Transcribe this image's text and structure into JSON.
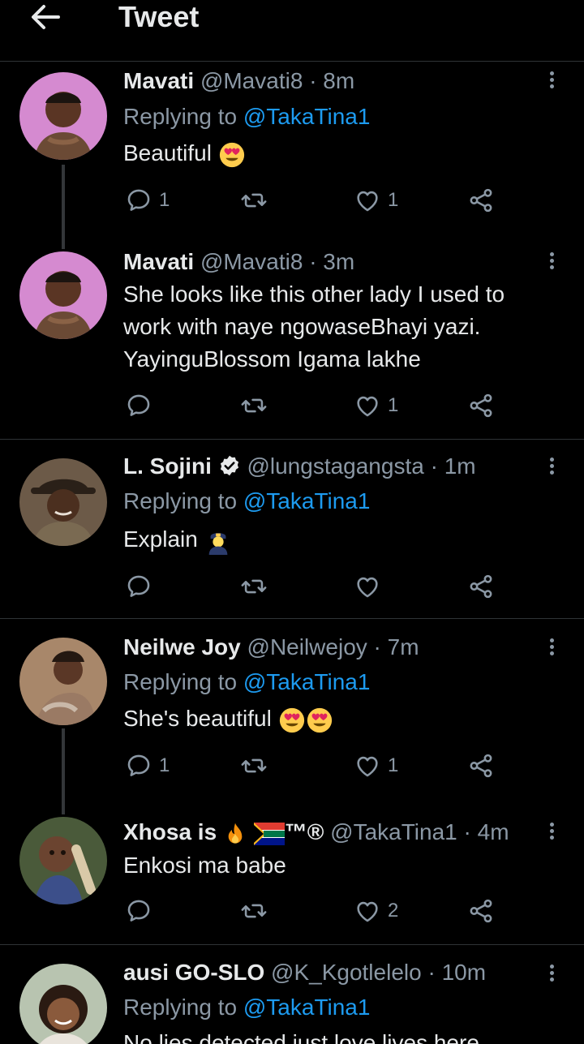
{
  "header": {
    "title": "Tweet"
  },
  "tweets": [
    {
      "name": "Mavati",
      "handle": "@Mavati8",
      "time": "· 8m",
      "reply_prefix": "Replying to",
      "reply_to": "@TakaTina1",
      "text": "Beautiful",
      "reply_count": "1",
      "retweet_count": "",
      "like_count": "1"
    },
    {
      "name": "Mavati",
      "handle": "@Mavati8",
      "time": "· 3m",
      "text_lines": [
        "She looks like this other lady I used to",
        "work with naye ngowaseBhayi yazi.",
        "YayinguBlossom Igama lakhe"
      ],
      "reply_count": "",
      "retweet_count": "",
      "like_count": "1"
    },
    {
      "name": "L. Sojini",
      "handle": "@lungstagangsta",
      "time": "· 1m",
      "reply_prefix": "Replying to",
      "reply_to": "@TakaTina1",
      "text": "Explain",
      "reply_count": "",
      "retweet_count": "",
      "like_count": ""
    },
    {
      "name": "Neilwe Joy",
      "handle": "@Neilwejoy",
      "time": "· 7m",
      "reply_prefix": "Replying to",
      "reply_to": "@TakaTina1",
      "text": "She's beautiful",
      "reply_count": "1",
      "retweet_count": "",
      "like_count": "1"
    },
    {
      "name": "Xhosa is",
      "name_suffix": "™®",
      "handle": "@TakaTina1",
      "time": "· 4m",
      "text": "Enkosi ma babe",
      "reply_count": "",
      "retweet_count": "",
      "like_count": "2"
    },
    {
      "name": "ausi GO-SLO",
      "handle": "@K_Kgotlelelo",
      "time": "· 10m",
      "reply_prefix": "Replying to",
      "reply_to": "@TakaTina1",
      "text": "No lies detected just love lives here"
    }
  ],
  "icons": {
    "back": "arrow-left-icon",
    "more": "more-vertical-icon",
    "reply": "reply-icon",
    "retweet": "retweet-icon",
    "like": "heart-icon",
    "share": "share-icon",
    "verified": "verified-badge-icon"
  },
  "colors": {
    "background": "#000000",
    "text": "#e7e9ea",
    "secondary": "#8b98a5",
    "link": "#1d9bf0",
    "divider": "#2f3336"
  }
}
